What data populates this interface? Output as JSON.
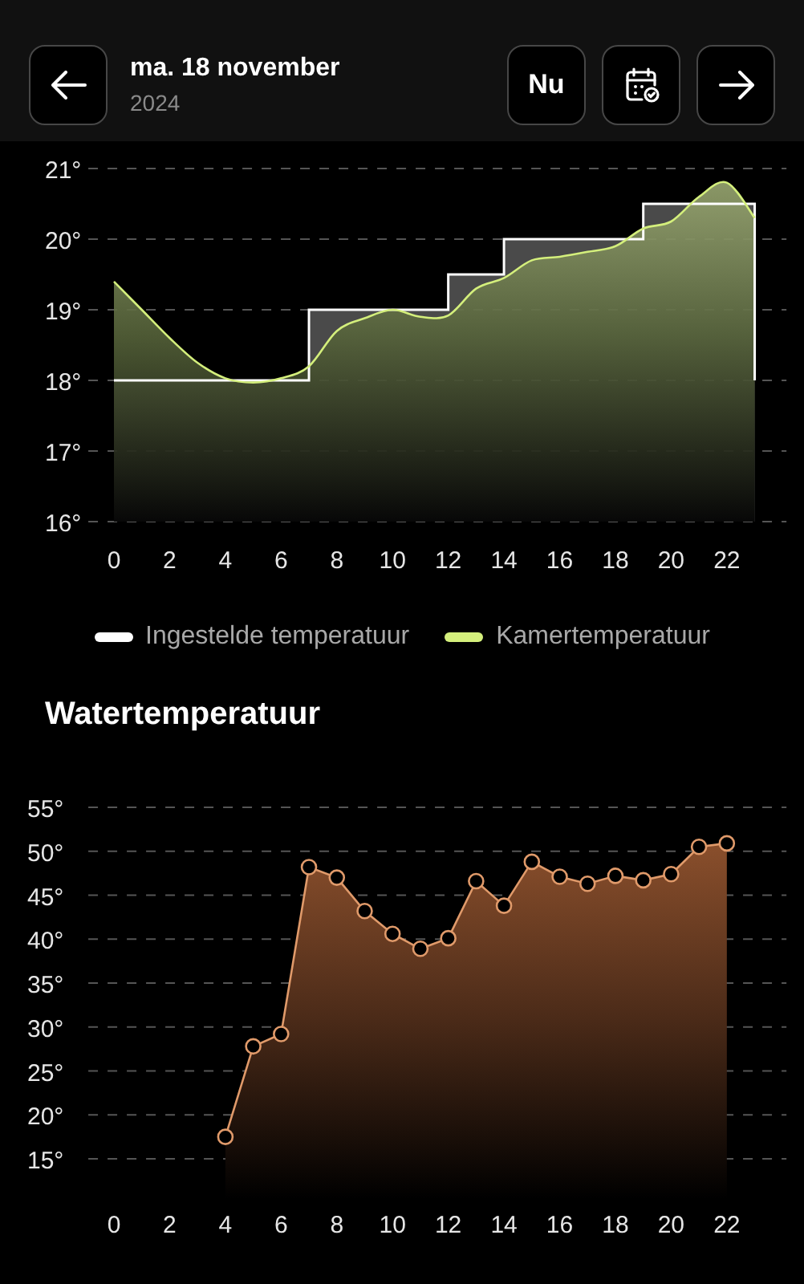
{
  "header": {
    "date": "ma. 18 november",
    "year": "2024",
    "today_button": "Nu"
  },
  "room_chart": {
    "chart_data": {
      "type": "area",
      "grid": true,
      "legend": "bottom",
      "x": [
        0,
        1,
        2,
        3,
        4,
        5,
        6,
        7,
        7,
        8,
        9,
        10,
        11,
        12,
        12,
        13,
        14,
        14,
        15,
        16,
        17,
        18,
        19,
        19,
        20,
        21,
        22,
        23,
        23
      ],
      "xticks": [
        0,
        2,
        4,
        6,
        8,
        10,
        12,
        14,
        16,
        18,
        20,
        22
      ],
      "xlim": [
        -0.92,
        24.14
      ],
      "ylim": [
        16,
        21
      ],
      "yticks": [
        {
          "value": 16,
          "label": "16°"
        },
        {
          "value": 17,
          "label": "17°"
        },
        {
          "value": 18,
          "label": "18°"
        },
        {
          "value": 19,
          "label": "19°"
        },
        {
          "value": 20,
          "label": "20°"
        },
        {
          "value": 21,
          "label": "21°"
        }
      ],
      "series": [
        {
          "name": "Ingestelde temperatuur",
          "color": "#ffffff",
          "values": [
            18,
            18,
            18,
            18,
            18,
            18,
            18,
            18,
            19,
            19,
            19,
            19,
            19,
            19,
            19.5,
            19.5,
            19.5,
            20,
            20,
            20,
            20,
            20,
            20,
            20.5,
            20.5,
            20.5,
            20.5,
            20.5,
            18
          ]
        },
        {
          "name": "Kamertemperatuur",
          "color": "#d4ef7c",
          "values": [
            19.4,
            19.0,
            18.6,
            18.25,
            18.03,
            17.97,
            18.03,
            18.2,
            18.2,
            18.7,
            18.88,
            19.0,
            18.9,
            18.92,
            18.92,
            19.3,
            19.45,
            19.45,
            19.7,
            19.75,
            19.82,
            19.9,
            20.15,
            20.15,
            20.25,
            20.6,
            20.8,
            20.3,
            20.3
          ]
        }
      ]
    }
  },
  "water_chart": {
    "chart_data": {
      "type": "area",
      "grid": true,
      "title": "Watertemperatuur",
      "x": [
        4,
        5,
        6,
        7,
        8,
        9,
        10,
        11,
        12,
        13,
        14,
        15,
        16,
        17,
        18,
        19,
        20,
        21,
        22
      ],
      "xticks": [
        0,
        2,
        4,
        6,
        8,
        10,
        12,
        14,
        16,
        18,
        20,
        22
      ],
      "xlim": [
        -0.92,
        24.14
      ],
      "ylim": [
        15,
        55
      ],
      "yticks": [
        {
          "value": 15,
          "label": "15°"
        },
        {
          "value": 20,
          "label": "20°"
        },
        {
          "value": 25,
          "label": "25°"
        },
        {
          "value": 30,
          "label": "30°"
        },
        {
          "value": 35,
          "label": "35°"
        },
        {
          "value": 40,
          "label": "40°"
        },
        {
          "value": 45,
          "label": "45°"
        },
        {
          "value": 50,
          "label": "50°"
        },
        {
          "value": 55,
          "label": "55°"
        }
      ],
      "series": [
        {
          "color": "#e09a6a",
          "values": [
            17.5,
            27.8,
            29.2,
            48.2,
            47,
            43.2,
            40.6,
            38.9,
            40.1,
            46.6,
            43.8,
            48.8,
            47.1,
            46.3,
            47.2,
            46.7,
            47.4,
            50.5,
            50.9
          ]
        }
      ]
    }
  }
}
